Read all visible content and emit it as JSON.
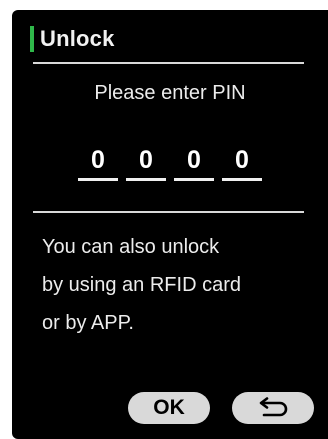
{
  "header": {
    "title": "Unlock"
  },
  "prompt": "Please enter  PIN",
  "pin": {
    "digits": [
      "0",
      "0",
      "0",
      "0"
    ]
  },
  "info": {
    "lines": [
      "You can also unlock",
      "by using an RFID card",
      "or by APP."
    ]
  },
  "buttons": {
    "ok_label": "OK",
    "back_icon": "return-arrow-icon"
  },
  "colors": {
    "accent": "#2fb84a",
    "background": "#000000",
    "button": "#d9d9d9"
  }
}
